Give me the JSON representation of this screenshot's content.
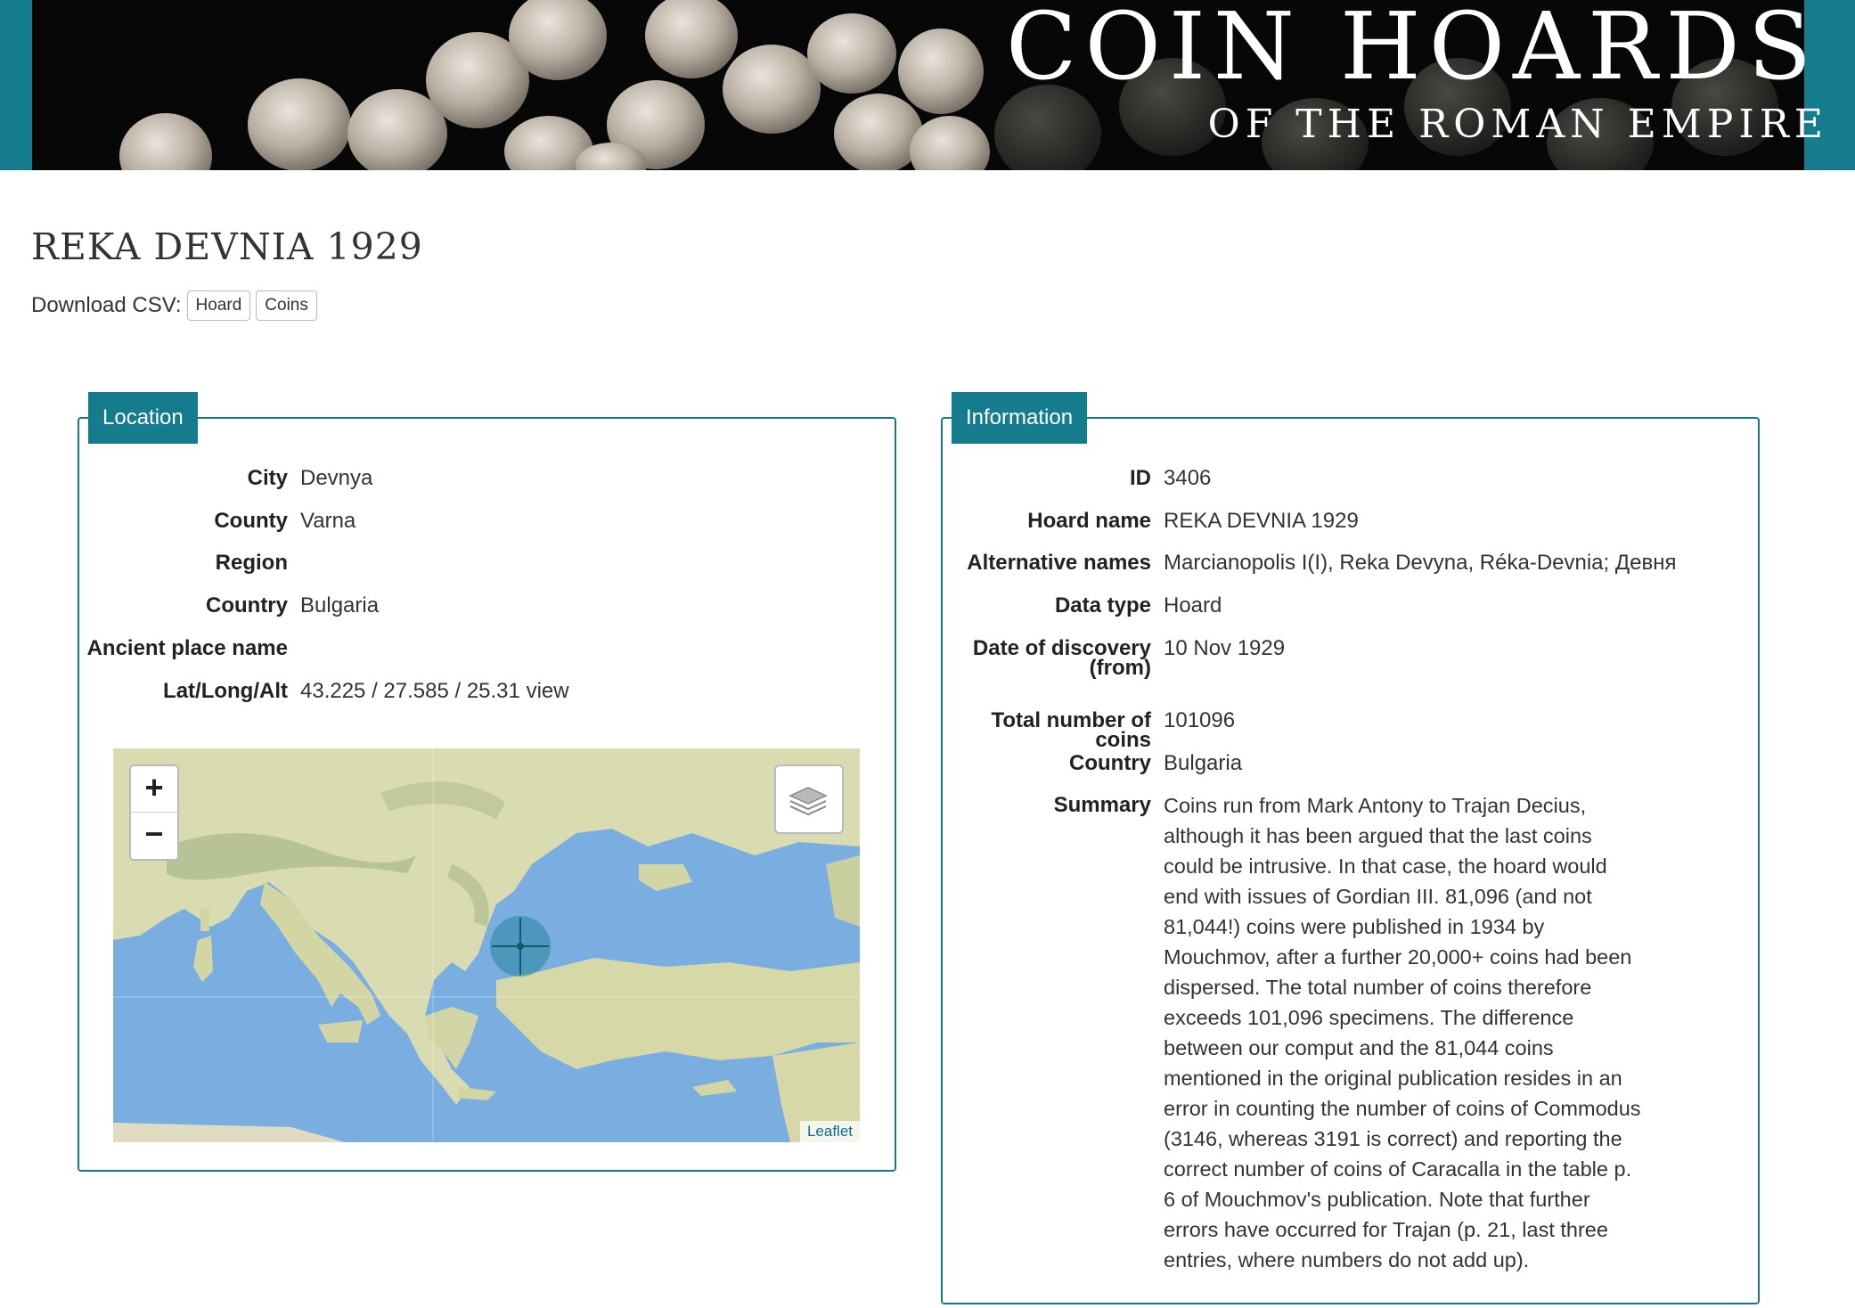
{
  "banner": {
    "title": "COIN HOARDS",
    "subtitle": "OF THE ROMAN EMPIRE"
  },
  "hoard": {
    "title": "REKA DEVNIA 1929"
  },
  "csv": {
    "label": "Download CSV:",
    "buttons": [
      "Hoard",
      "Coins"
    ]
  },
  "location": {
    "tab_label": "Location",
    "fields": [
      {
        "label": "City",
        "value": "Devnya"
      },
      {
        "label": "County",
        "value": "Varna"
      },
      {
        "label": "Region",
        "value": ""
      },
      {
        "label": "Country",
        "value": "Bulgaria"
      },
      {
        "label": "Ancient place name",
        "value": ""
      },
      {
        "label": "Lat/Long/Alt",
        "value": "43.225 / 27.585 / 25.31"
      }
    ],
    "view_link": "view",
    "map": {
      "zoom_in": "+",
      "zoom_out": "−",
      "attribution": "Leaflet",
      "marker_color": "#157c8d"
    }
  },
  "information": {
    "tab_label": "Information",
    "fields": [
      {
        "label": "ID",
        "value": "3406"
      },
      {
        "label": "Hoard name",
        "value": "REKA DEVNIA 1929"
      },
      {
        "label": "Alternative names",
        "value": "Marcianopolis I(I), Reka Devyna, Réka-Devnia; Девня"
      },
      {
        "label": "Data type",
        "value": "Hoard"
      },
      {
        "label": "Date of discovery (from)",
        "value": "10 Nov 1929"
      },
      {
        "label": "Total number of coins",
        "value": "101096"
      },
      {
        "label": "Country",
        "value": "Bulgaria"
      },
      {
        "label": "Summary",
        "value": "Coins run from Mark Antony to Trajan Decius, although it has been argued that the last coins could be intrusive. In that case, the hoard would end with issues of Gordian III. 81,096 (and not 81,044!) coins were published in 1934 by Mouchmov, after a further 20,000+ coins had been dispersed. The total number of coins therefore exceeds 101,096 specimens. The difference between our comput and the 81,044 coins mentioned in the original publication resides in an error in counting the number of coins of Commodus (3146, whereas 3191 is correct) and reporting the correct number of coins of Caracalla in the table p. 6 of Mouchmov's publication. Note that further errors have occurred for Trajan (p. 21, last three entries, where numbers do not add up)."
      }
    ]
  },
  "colors": {
    "accent": "#157c8d",
    "panel_border": "#1b7787",
    "sea": "#7aaee0",
    "land": "#d9dcb0"
  }
}
